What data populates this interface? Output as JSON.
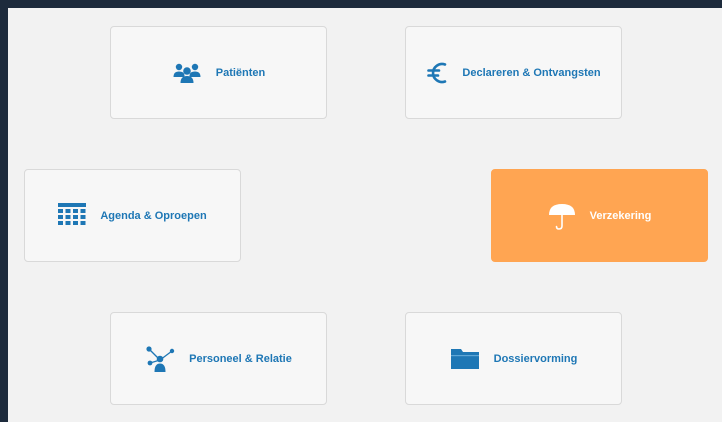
{
  "colors": {
    "frame": "#1d2b3c",
    "background": "#f2f2f2",
    "tile": "#f7f7f7",
    "tile_border": "#d9d9d9",
    "accent": "#1e77b5",
    "active": "#ffa552",
    "active_text": "#ffffff"
  },
  "tiles": {
    "patienten": {
      "label": "Patiënten",
      "icon": "users-icon"
    },
    "declareren": {
      "label": "Declareren & Ontvangsten",
      "icon": "euro-icon"
    },
    "agenda": {
      "label": "Agenda & Oproepen",
      "icon": "calendar-grid-icon"
    },
    "verzekering": {
      "label": "Verzekering",
      "icon": "umbrella-icon",
      "selected": true
    },
    "personeel": {
      "label": "Personeel & Relatie",
      "icon": "network-person-icon"
    },
    "dossier": {
      "label": "Dossiervorming",
      "icon": "folder-icon"
    }
  }
}
